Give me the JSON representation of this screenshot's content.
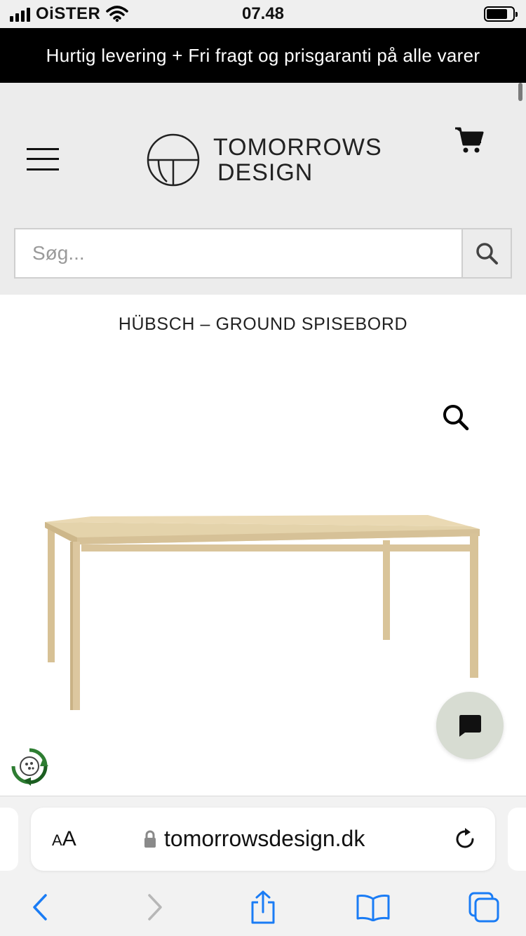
{
  "status_bar": {
    "carrier": "OiSTER",
    "time": "07.48",
    "battery_level": 0.8
  },
  "promo_banner": {
    "text": "Hurtig levering + Fri fragt og prisgaranti på alle varer"
  },
  "header": {
    "logo_line1": "TOMORROWS",
    "logo_line2": "DESIGN",
    "search_placeholder": "Søg..."
  },
  "product": {
    "title": "HÜBSCH – GROUND SPISEBORD"
  },
  "browser": {
    "text_size_label_small": "A",
    "text_size_label_large": "A",
    "url": "tomorrowsdesign.dk"
  },
  "colors": {
    "banner_bg": "#000000",
    "header_bg": "#ececec",
    "safari_blue": "#1a7cf5",
    "chat_bubble": "#d7dcd2",
    "eco_green": "#2e7d32"
  },
  "icons": {
    "menu": "hamburger-icon",
    "cart": "cart-icon",
    "search": "search-icon",
    "zoom": "zoom-icon",
    "chat": "chat-icon",
    "eco": "recycle-badge-icon",
    "back": "chevron-left-icon",
    "forward": "chevron-right-icon",
    "share": "share-icon",
    "bookmarks": "bookmarks-icon",
    "tabs": "tabs-icon"
  }
}
